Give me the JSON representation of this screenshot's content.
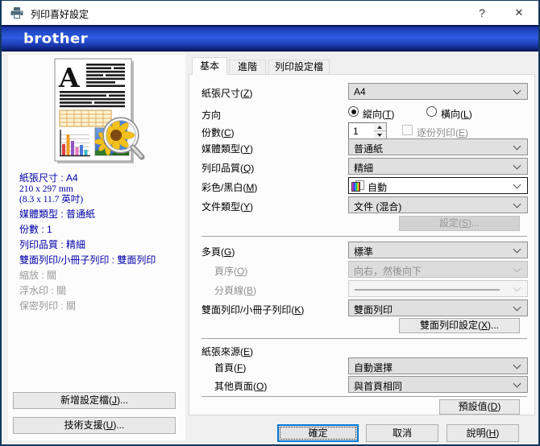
{
  "window": {
    "title": "列印喜好設定",
    "help_glyph": "?",
    "close_glyph": "✕"
  },
  "brand": {
    "logo_text": "brother"
  },
  "icons": {
    "app": "printer-icon",
    "combo_arrow": "chevron-down-icon",
    "color_mode": "color-pages-icon",
    "preview": "document-preview-with-magnifier"
  },
  "colors": {
    "brand_blue": "#2f5ce4",
    "accent_blue": "#0078d7",
    "summary_text": "#0000a8",
    "window_border": "#11375e"
  },
  "sidebar": {
    "summary": [
      {
        "text": "紙張尺寸 : A4"
      },
      {
        "text": "210 x 297 mm"
      },
      {
        "text": "(8.3 x 11.7 英吋)"
      },
      {
        "text": "媒體類型 : 普通紙"
      },
      {
        "text": "份數 : 1"
      },
      {
        "text": "列印品質 : 精細"
      },
      {
        "text": "雙面列印/小冊子列印 : 雙面列印"
      },
      {
        "text": "縮放 : 關"
      },
      {
        "text": "浮水印 : 關"
      },
      {
        "text": "保密列印 : 關"
      }
    ],
    "add_profile_button": "新增設定檔(J)...",
    "support_button": "技術支援(U)..."
  },
  "tabs": [
    {
      "label": "基本",
      "active": true
    },
    {
      "label": "進階",
      "active": false
    },
    {
      "label": "列印設定檔",
      "active": false
    }
  ],
  "form": {
    "paper_size": {
      "label": "紙張尺寸(Z)",
      "value": "A4"
    },
    "orientation": {
      "label": "方向",
      "portrait": "縱向(T)",
      "landscape": "橫向(L)",
      "selected": "portrait"
    },
    "copies": {
      "label": "份數(C)",
      "value": "1",
      "collate_label": "逐份列印(E)",
      "collate_checked": false
    },
    "media_type": {
      "label": "媒體類型(Y)",
      "value": "普通紙"
    },
    "print_quality": {
      "label": "列印品質(Q)",
      "value": "精細"
    },
    "color_mono": {
      "label": "彩色/黑白(M)",
      "value": "自動"
    },
    "document_type": {
      "label": "文件類型(Y)",
      "value": "文件 (混合)"
    },
    "settings_button": "設定(S)...",
    "multi_page": {
      "label": "多頁(G)",
      "value": "標準"
    },
    "page_order": {
      "label": "頁序(O)",
      "value": "向右，然後向下"
    },
    "border_line": {
      "label": "分頁線(B)",
      "value": ""
    },
    "duplex": {
      "label": "雙面列印/小冊子列印(K)",
      "value": "雙面列印"
    },
    "duplex_settings_button": "雙面列印設定(X)...",
    "paper_source": {
      "label": "紙張來源(E)",
      "first_page": {
        "label": "首頁(F)",
        "value": "自動選擇"
      },
      "other_pages": {
        "label": "其他頁面(O)",
        "value": "與首頁相同"
      }
    },
    "default_button": "預設值(D)"
  },
  "footer": {
    "ok": "確定",
    "cancel": "取消",
    "help": "說明(H)"
  }
}
